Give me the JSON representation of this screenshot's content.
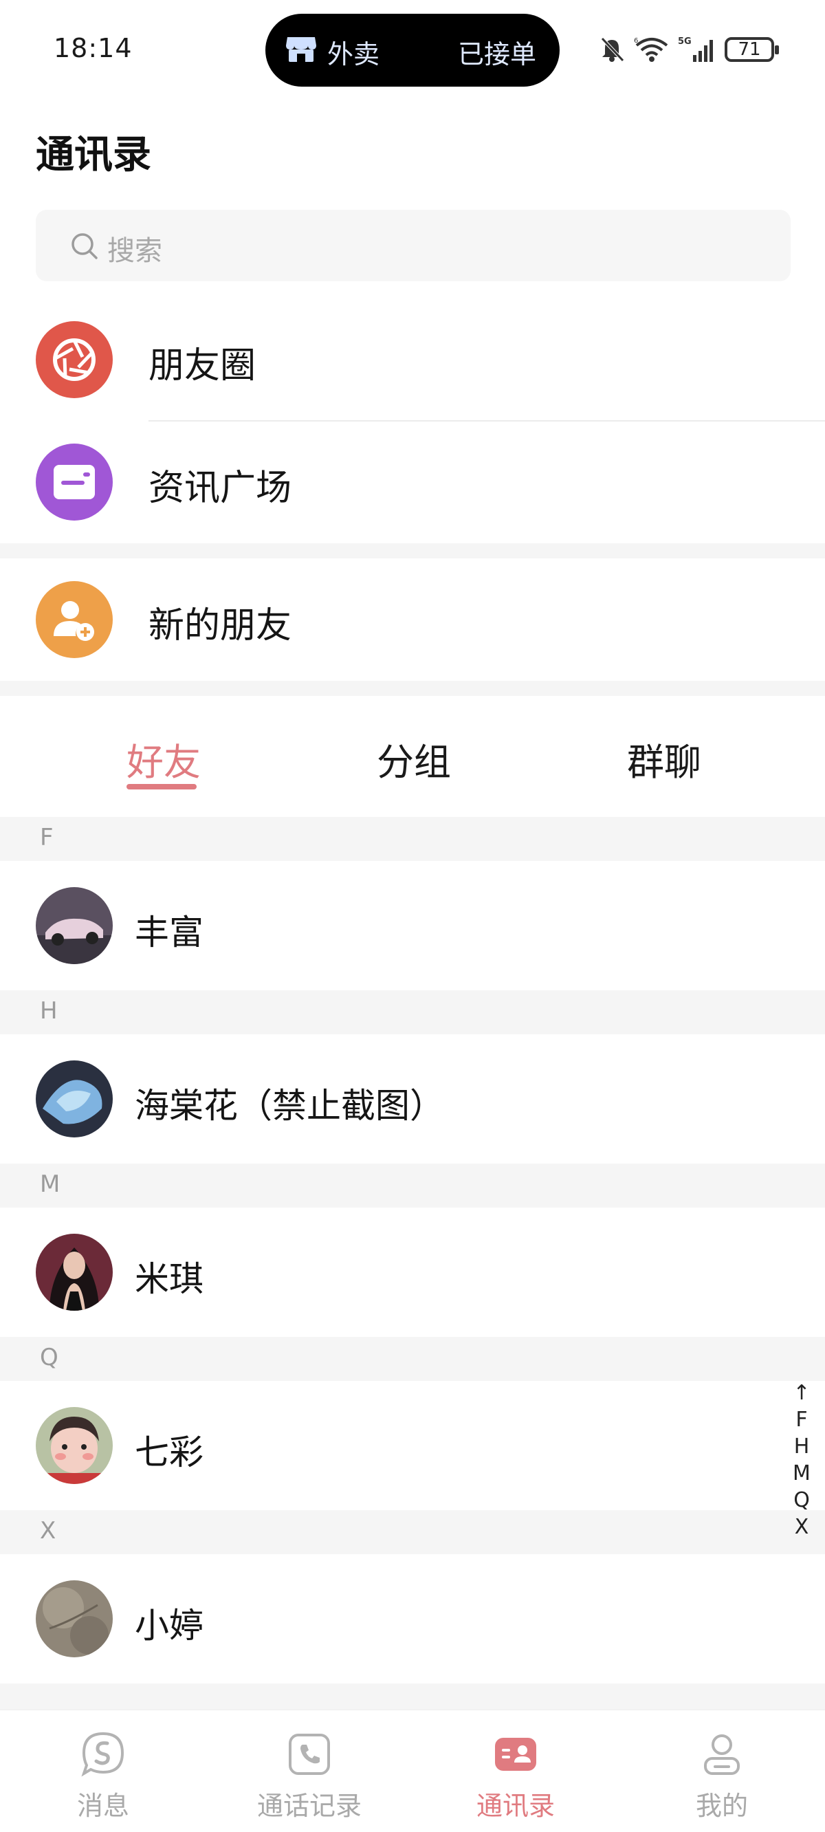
{
  "status_bar": {
    "time": "18:14",
    "island_left": "外卖",
    "island_right": "已接单",
    "battery": "71",
    "network": "5G"
  },
  "header": {
    "title": "通讯录",
    "search_placeholder": "搜索"
  },
  "entries": [
    {
      "label": "朋友圈",
      "icon": "moments-aperture-icon",
      "color": "#e0574a"
    },
    {
      "label": "资讯广场",
      "icon": "news-square-icon",
      "color": "#a057d6"
    },
    {
      "label": "新的朋友",
      "icon": "new-friend-icon",
      "color": "#eea049"
    }
  ],
  "tabs": [
    {
      "label": "好友",
      "active": true
    },
    {
      "label": "分组",
      "active": false
    },
    {
      "label": "群聊",
      "active": false
    }
  ],
  "sections": [
    {
      "letter": "F",
      "contacts": [
        {
          "name": "丰富"
        }
      ]
    },
    {
      "letter": "H",
      "contacts": [
        {
          "name": "海棠花（禁止截图）"
        }
      ]
    },
    {
      "letter": "M",
      "contacts": [
        {
          "name": "米琪"
        }
      ]
    },
    {
      "letter": "Q",
      "contacts": [
        {
          "name": "七彩"
        }
      ]
    },
    {
      "letter": "X",
      "contacts": [
        {
          "name": "小婷"
        }
      ]
    }
  ],
  "index_bar": [
    "↑",
    "F",
    "H",
    "M",
    "Q",
    "X"
  ],
  "bottom_nav": [
    {
      "label": "消息",
      "icon": "message-icon",
      "active": false
    },
    {
      "label": "通话记录",
      "icon": "call-log-icon",
      "active": false
    },
    {
      "label": "通讯录",
      "icon": "contacts-icon",
      "active": true
    },
    {
      "label": "我的",
      "icon": "profile-icon",
      "active": false
    }
  ],
  "colors": {
    "accent": "#e07b80",
    "moments": "#e0574a",
    "news": "#a057d6",
    "new_friend": "#eea049"
  }
}
